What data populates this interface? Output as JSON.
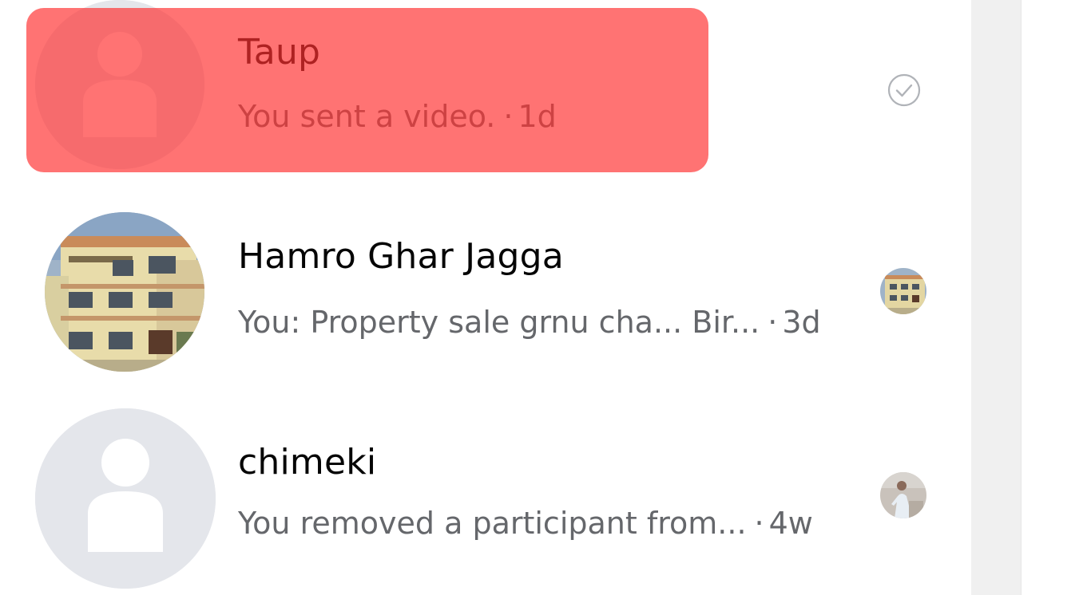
{
  "conversations": [
    {
      "name": "Taup",
      "preview": "You sent a video.",
      "time": "1d",
      "avatar_icon": "default-profile-icon",
      "status_icon": "sent-check-icon"
    },
    {
      "name": "Hamro Ghar Jagga",
      "preview": "You: Property sale grnu cha... Bir...",
      "time": "3d",
      "avatar_icon": "building-photo-avatar",
      "status_icon": "seen-avatar-building"
    },
    {
      "name": "chimeki",
      "preview": "You removed a participant from...",
      "time": "4w",
      "avatar_icon": "default-profile-icon",
      "status_icon": "seen-avatar-person"
    }
  ],
  "separator": "·",
  "colors": {
    "highlight": "#ff3030",
    "name_text": "#050505",
    "preview_text": "#65676b",
    "avatar_placeholder": "#e4e6eb",
    "scrollbar_track": "#f0f0f0"
  }
}
